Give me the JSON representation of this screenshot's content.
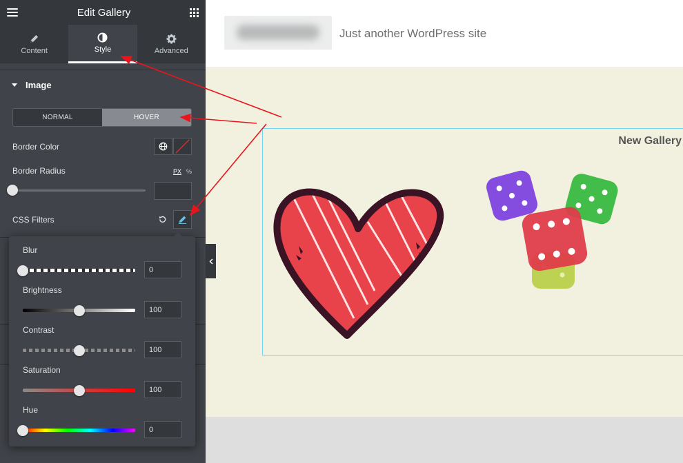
{
  "panel": {
    "title": "Edit Gallery",
    "tabs": [
      {
        "label": "Content",
        "icon": "pencil-icon"
      },
      {
        "label": "Style",
        "icon": "half-circle-icon",
        "active": true
      },
      {
        "label": "Advanced",
        "icon": "gear-icon"
      }
    ],
    "section_title": "Image",
    "state_toggle": {
      "normal": "NORMAL",
      "hover": "HOVER",
      "selected": "HOVER"
    },
    "border_color_label": "Border Color",
    "border_radius_label": "Border Radius",
    "units": {
      "px": "PX",
      "percent": "%"
    },
    "border_radius_value": "",
    "css_filters_label": "CSS Filters"
  },
  "css_filters": {
    "blur": {
      "label": "Blur",
      "value": "0",
      "fraction": 0
    },
    "brightness": {
      "label": "Brightness",
      "value": "100",
      "fraction": 0.5
    },
    "contrast": {
      "label": "Contrast",
      "value": "100",
      "fraction": 0.5
    },
    "saturation": {
      "label": "Saturation",
      "value": "100",
      "fraction": 0.5
    },
    "hue": {
      "label": "Hue",
      "value": "0",
      "fraction": 0
    }
  },
  "preview": {
    "tagline": "Just another WordPress site",
    "gallery_title": "New Gallery"
  },
  "colors": {
    "panel_bg": "#404349",
    "panel_header": "#34383c",
    "annotation_arrow": "#e8161c",
    "widget_outline": "#71d7f7",
    "content_bg": "#f2f0de"
  }
}
